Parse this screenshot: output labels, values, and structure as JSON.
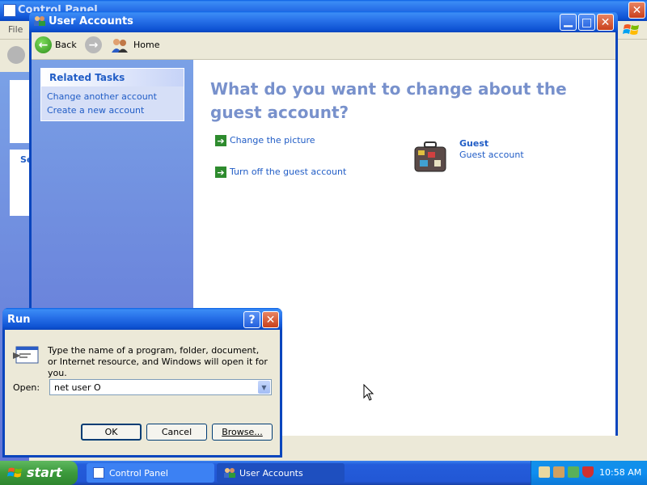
{
  "background_window": {
    "title": "Control Panel",
    "menu_first": "File",
    "sidebar_label": "Se"
  },
  "user_accounts": {
    "title": "User Accounts",
    "toolbar": {
      "back_label": "Back",
      "home_label": "Home"
    },
    "related_tasks": {
      "header": "Related Tasks",
      "items": [
        "Change another account",
        "Create a new account"
      ]
    },
    "heading": "What do you want to change about the guest account?",
    "actions": [
      "Change the picture",
      "Turn off the guest account"
    ],
    "account": {
      "name": "Guest",
      "type": "Guest account"
    }
  },
  "run_dialog": {
    "title": "Run",
    "description": "Type the name of a program, folder, document, or Internet resource, and Windows will open it for you.",
    "open_label": "Open:",
    "open_value": "net user O",
    "ok_label": "OK",
    "cancel_label": "Cancel",
    "browse_label": "Browse..."
  },
  "taskbar": {
    "start_label": "start",
    "buttons": [
      "Control Panel",
      "User Accounts"
    ],
    "clock": "10:58 AM"
  },
  "colors": {
    "desktop": "#5a7edc",
    "heading": "#7891cc",
    "link": "#215dc6",
    "start_button": "#3c9a3c",
    "taskbar": "#245ddb",
    "tray": "#0f8ef0"
  }
}
